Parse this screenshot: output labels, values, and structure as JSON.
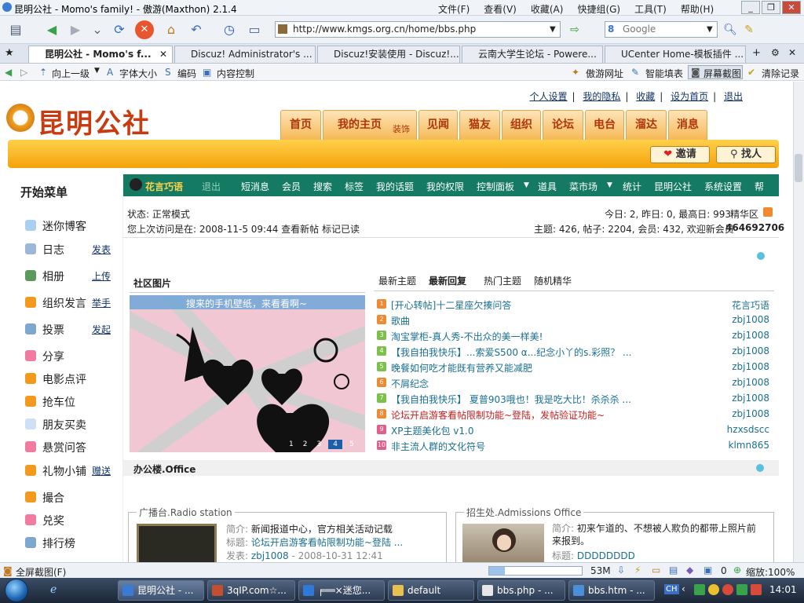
{
  "window": {
    "title": "昆明公社 - Momo's family! - 傲游(Maxthon) 2.1.4",
    "menus": [
      "文件(F)",
      "查看(V)",
      "收藏(A)",
      "快捷组(G)",
      "工具(T)",
      "帮助(H)"
    ]
  },
  "toolbar": {
    "address": "http://www.kmgs.org.cn/home/bbs.php",
    "search_placeholder": "Google"
  },
  "tabs": [
    {
      "label": "昆明公社 - Momo's f..."
    },
    {
      "label": "Discuz! Administrator's ..."
    },
    {
      "label": "Discuz!安装使用 - Discuz!..."
    },
    {
      "label": "云南大学生论坛 - Powere..."
    },
    {
      "label": "UCenter Home-模板插件 ..."
    }
  ],
  "bookmarks": {
    "left": [
      "向上一级",
      "字体大小",
      "编码",
      "内容控制"
    ],
    "right": [
      "傲游网址",
      "智能填表",
      "屏幕截图",
      "清除记录"
    ]
  },
  "site": {
    "logo": "昆明公社",
    "top_links": [
      "个人设置",
      "我的隐私",
      "收藏",
      "设为首页",
      "退出"
    ],
    "nav": [
      "首页",
      "我的主页",
      "见闻",
      "猫友",
      "组织",
      "论坛",
      "电台",
      "溜达",
      "消息"
    ],
    "nav_sub": "装饰",
    "invite": "邀请",
    "find": "找人"
  },
  "left_menu": {
    "heading": "开始菜单",
    "items": [
      {
        "label": "迷你博客",
        "sub": ""
      },
      {
        "label": "日志",
        "sub": "发表"
      },
      {
        "label": "相册",
        "sub": "上传"
      },
      {
        "label": "组织发言",
        "sub": "举手"
      },
      {
        "label": "投票",
        "sub": "发起"
      },
      {
        "label": "分享",
        "sub": ""
      },
      {
        "label": "电影点评",
        "sub": ""
      },
      {
        "label": "抢车位",
        "sub": ""
      },
      {
        "label": "朋友买卖",
        "sub": ""
      },
      {
        "label": "悬赏问答",
        "sub": ""
      },
      {
        "label": "礼物小铺",
        "sub": "赠送"
      },
      {
        "label": "撮合",
        "sub": ""
      },
      {
        "label": "兑奖",
        "sub": ""
      },
      {
        "label": "排行榜",
        "sub": ""
      }
    ]
  },
  "forum_bar": {
    "user": "花言巧语",
    "logout": "退出",
    "items": [
      "短消息",
      "会员",
      "搜索",
      "标签",
      "我的话题",
      "我的权限",
      "控制面板",
      "道具",
      "菜市场",
      "统计",
      "昆明公社",
      "系统设置",
      "帮"
    ]
  },
  "status": {
    "mode": "状态: 正常模式",
    "last_visit": "您上次访问是在: 2008-11-5 09:44 查看新帖  标记已读",
    "today": "今日: 2, 昨日: 0, 最高日: 993",
    "jinghua": "精华区",
    "stats": "主题: 426, 帖子: 2204, 会员: 432, 欢迎新会员",
    "newest_member": "464692706"
  },
  "community_pics": {
    "title": "社区图片",
    "caption": "搜来的手机壁纸，来看看啊~",
    "pages": [
      "1",
      "2",
      "3",
      "4",
      "5"
    ]
  },
  "threads": {
    "tabs": [
      "最新主题",
      "最新回复",
      "热门主题",
      "随机精华"
    ],
    "rows": [
      {
        "title": "[开心转帖]十二星座欠揍问答",
        "author": "花言巧语",
        "red": false
      },
      {
        "title": "歌曲",
        "author": "zbj1008",
        "red": false
      },
      {
        "title": "淘宝掌柜-真人秀-不出众的美一样美!",
        "author": "zbj1008",
        "red": false
      },
      {
        "title": "【我自拍我快乐】...索爱S500 α...纪念小丫的s.彩照？ ...",
        "author": "zbj1008",
        "red": false
      },
      {
        "title": "晚餐如何吃才能既有营养又能减肥",
        "author": "zbj1008",
        "red": false
      },
      {
        "title": "不屑纪念",
        "author": "zbj1008",
        "red": false
      },
      {
        "title": "【我自拍我快乐】 夏普903哦也！我是吃大比！杀杀杀 ...",
        "author": "zbj1008",
        "red": false
      },
      {
        "title": "论坛开启游客看帖限制功能~登陆，发帖验证功能~",
        "author": "zbj1008",
        "red": true
      },
      {
        "title": "XP主题美化包 v1.0",
        "author": "hzxsdscc",
        "red": false
      },
      {
        "title": "非主流人群的文化符号",
        "author": "klmn865",
        "red": false
      }
    ]
  },
  "office": {
    "title": "办公楼.Office",
    "radio": {
      "legend": "广播台.Radio station",
      "intro_label": "简介",
      "intro": "新闻报道中心，官方相关活动记载",
      "topic_label": "标题",
      "topic": "论坛开启游客看帖限制功能~登陆 ...",
      "post_label": "发表",
      "post_user": "zbj1008",
      "post_time": "- 2008-10-31 12:41"
    },
    "admissions": {
      "legend": "招生处.Admissions Office",
      "intro_label": "简介",
      "intro": "初来乍道的、不想被人欺负的都带上照片前来报到。",
      "topic_label": "标题",
      "topic": "DDDDDDDD"
    }
  },
  "statusbar": {
    "left": "全屏截图(F)",
    "mem": "53M",
    "zero": "0",
    "zoom": "缩放:100%"
  },
  "taskbar": {
    "items": [
      "昆明公社 - ...",
      "3qIP.com☆...",
      "╒══×迷您...",
      "default",
      "bbs.php - ...",
      "bbs.htm - ..."
    ],
    "lang": "CH",
    "clock": "14:01"
  },
  "colors": {
    "forum_bar": "#147a63",
    "nav_tab_text": "#b0350a",
    "orange_bar": "#f5a20a",
    "link": "#1a6f93"
  }
}
